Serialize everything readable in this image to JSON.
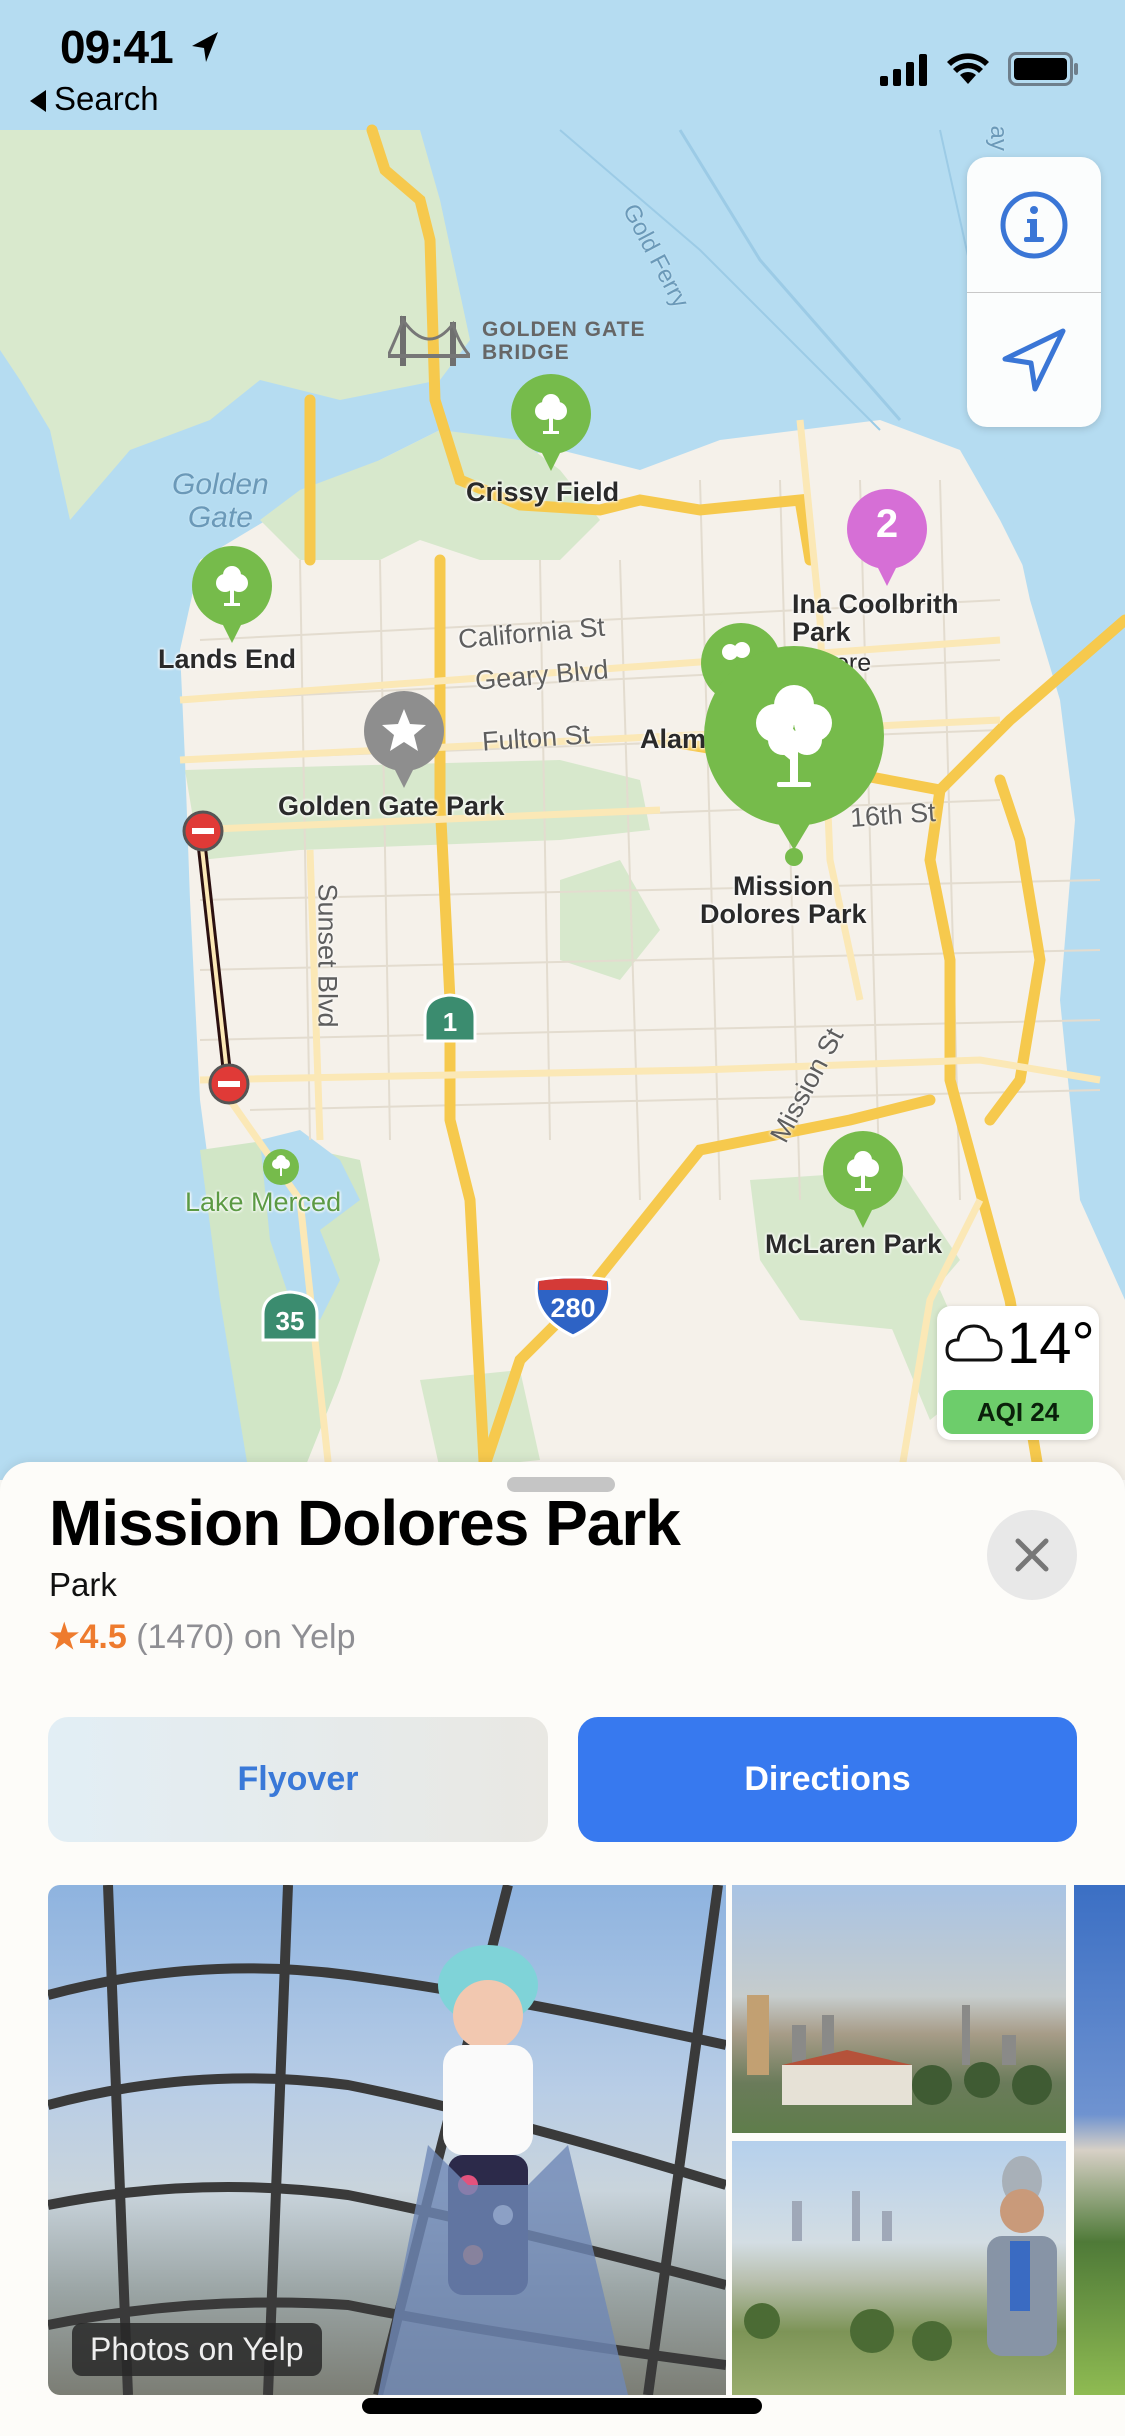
{
  "status_bar": {
    "time": "09:41",
    "location_arrow": "location-arrow-icon",
    "back_label": "Search",
    "icons": [
      "cellular-signal-icon",
      "wifi-icon",
      "battery-icon"
    ]
  },
  "map": {
    "water_labels": [
      "Golden",
      "Gate"
    ],
    "ferry_label": "Gold Ferry",
    "landmark": {
      "line1": "GOLDEN GATE",
      "line2": "BRIDGE",
      "icon": "bridge-icon"
    },
    "places": [
      {
        "name": "Crissy Field",
        "pin": "tree-icon",
        "color": "#76bb4b"
      },
      {
        "name": "Lands End",
        "pin": "tree-icon",
        "color": "#76bb4b"
      },
      {
        "name": "Golden Gate Park",
        "pin": "star-icon",
        "color": "#8e8e8e"
      },
      {
        "name_line1": "Ina Coolbrith",
        "name_line2": "Park",
        "pin_label": "2",
        "color": "#d66fd6"
      },
      {
        "name_line1": "Mission",
        "name_line2": "Dolores Park",
        "pin": "tree-icon",
        "color": "#76bb4b",
        "selected": true
      },
      {
        "name": "McLaren Park",
        "pin": "tree-icon",
        "color": "#76bb4b"
      },
      {
        "name": "Lake Merced",
        "pin": "tree-icon",
        "color": "#76bb4b"
      }
    ],
    "partial_labels": {
      "alamo": "Alam",
      "fillmore": "ore"
    },
    "streets": [
      "California St",
      "Geary Blvd",
      "Fulton St",
      "16th St",
      "Sunset Blvd",
      "Mission St"
    ],
    "shields": {
      "hwy1": "1",
      "hwy35": "35",
      "i280": "280"
    },
    "bay_label": "ay"
  },
  "map_controls": {
    "info": "info-icon",
    "location": "location-arrow-icon"
  },
  "weather": {
    "temperature": "14°",
    "icon": "cloud-icon",
    "aqi": "AQI 24",
    "aqi_color": "#6dcd6b"
  },
  "place_card": {
    "title": "Mission Dolores Park",
    "category": "Park",
    "rating_star": "★",
    "rating": "4.5",
    "review_count": "(1470)",
    "source": "on Yelp",
    "flyover_label": "Flyover",
    "directions_label": "Directions",
    "photos_badge": "Photos on Yelp",
    "accent": "#3779ef",
    "rating_color": "#ee7b2e"
  }
}
